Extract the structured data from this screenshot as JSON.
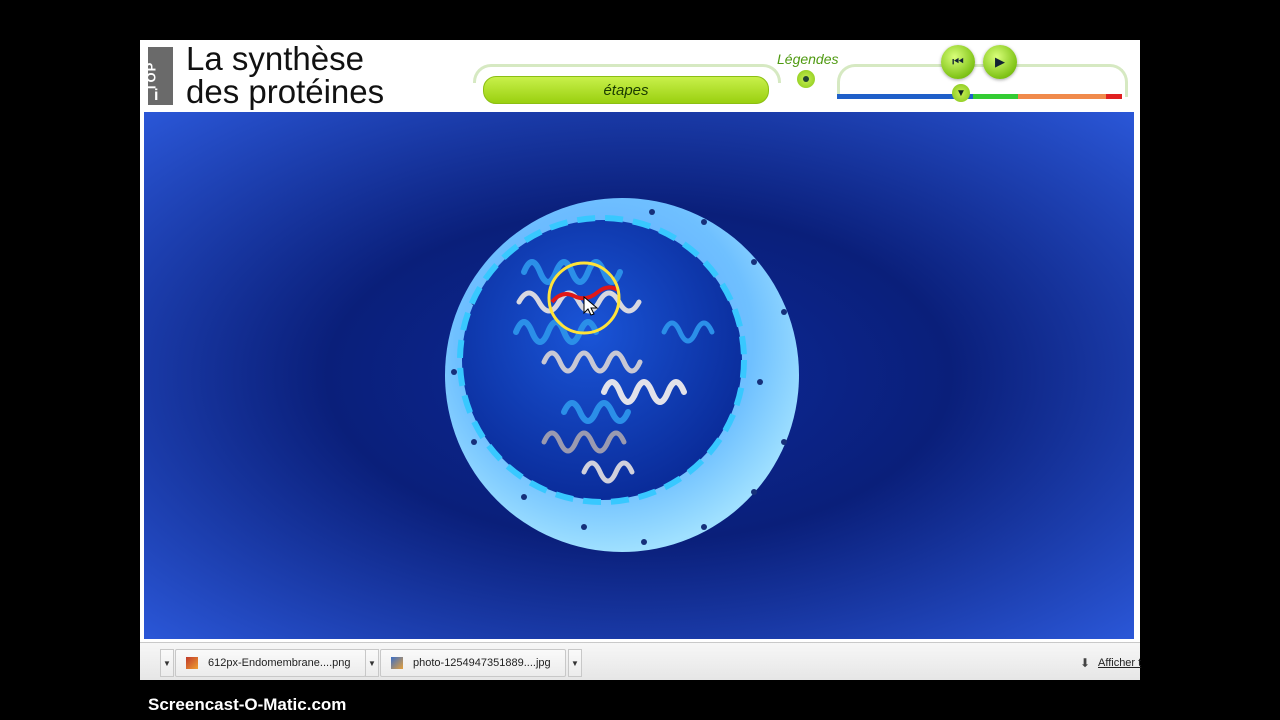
{
  "header": {
    "logo_text": "TOP",
    "title_line1": "La synthèse",
    "title_line2": "des protéines",
    "steps_label": "étapes",
    "legends_label": "Légendes"
  },
  "controls": {
    "rewind_symbol": "⏮",
    "play_symbol": "▶",
    "playhead_symbol": "▼",
    "timeline_position": 0.44
  },
  "colors": {
    "stage_bg": "#0b2a8f",
    "accent_green": "#9ad010",
    "timeline_blue": "#1f5fc9",
    "timeline_green": "#33cc33",
    "timeline_orange": "#f08a4b",
    "timeline_red": "#e02020"
  },
  "downloads": {
    "items": [
      {
        "label": "612px-Endomembrane....png",
        "icon": "png-file-icon"
      },
      {
        "label": "photo-1254947351889....jpg",
        "icon": "jpg-file-icon"
      }
    ],
    "show_all_label": "Afficher t"
  },
  "watermark": "Screencast-O-Matic.com"
}
